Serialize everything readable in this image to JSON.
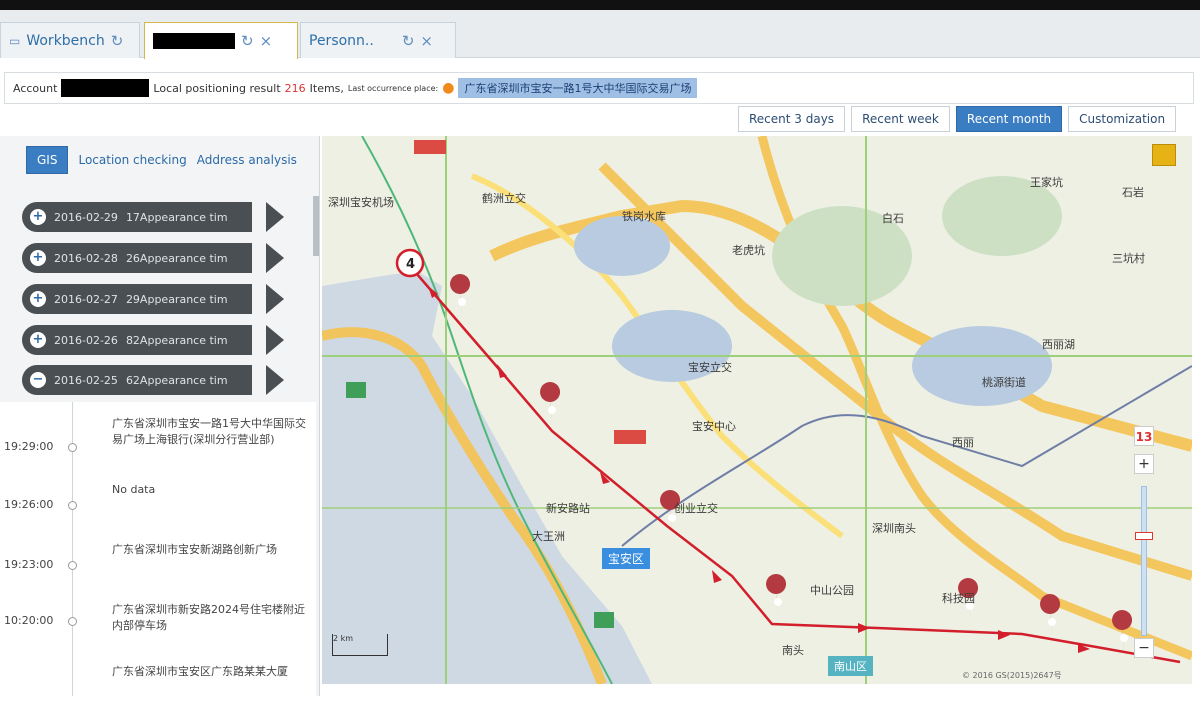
{
  "tabs": [
    {
      "label": "Workbench",
      "icon": "monitor-icon",
      "refresh_icon": "↻"
    },
    {
      "label": "",
      "refresh_icon": "↻",
      "close_icon": "×"
    },
    {
      "label": "Personn..",
      "refresh_icon": "↻",
      "close_icon": "×"
    }
  ],
  "infobar": {
    "account_label": "Account",
    "result_label": "Local positioning result",
    "count": "216",
    "items_label": "Items,",
    "last_place_label": "Last occurrence place:",
    "place_value": "广东省深圳市宝安一路1号大中华国际交易广场"
  },
  "ranges": [
    "Recent 3 days",
    "Recent week",
    "Recent month",
    "Customization"
  ],
  "left_tabs": [
    "GIS",
    "Location checking",
    "Address analysis"
  ],
  "days": [
    {
      "date": "2016-02-29",
      "count": "17Appearance tim",
      "sign": "+"
    },
    {
      "date": "2016-02-28",
      "count": "26Appearance tim",
      "sign": "+"
    },
    {
      "date": "2016-02-27",
      "count": "29Appearance tim",
      "sign": "+"
    },
    {
      "date": "2016-02-26",
      "count": "82Appearance tim",
      "sign": "+"
    },
    {
      "date": "2016-02-25",
      "count": "62Appearance tim",
      "sign": "−"
    }
  ],
  "timeline": [
    {
      "time": "19:29:00",
      "text": "广东省深圳市宝安一路1号大中华国际交易广场上海银行(深圳分行营业部)"
    },
    {
      "time": "19:26:00",
      "text": "No data"
    },
    {
      "time": "19:23:00",
      "text": "广东省深圳市宝安新湖路创新广场"
    },
    {
      "time": "10:20:00",
      "text": "广东省深圳市新安路2024号住宅楼附近内部停车场"
    },
    {
      "time": "",
      "text": "广东省深圳市宝安区广东路某某大厦"
    }
  ],
  "map": {
    "zoom_level": "13",
    "zoom_in": "+",
    "zoom_out": "−",
    "route_start_label": "4",
    "district_badge": "宝安区",
    "district_badge2": "南山区",
    "scale_label": "2 km",
    "copyright": "© 2016 GS(2015)2647号",
    "labels": {
      "airport": "深圳宝安机场",
      "hexi": "鹤洲立交",
      "tianhu": "铁岗水库",
      "laohukeng": "老虎坑",
      "baoan_lijiao": "宝安立交",
      "taoyuan": "桃源街道",
      "xili": "西丽",
      "baoan_center": "宝安中心",
      "xinghe": "新安路站",
      "xingye": "创业立交",
      "dawangzhou": "大王洲",
      "shenzhen_nanshan": "深圳南头",
      "zhongshan": "中山公园",
      "kejiyuan": "科技园",
      "nantou": "南头",
      "shiyan": "石岩",
      "wangjia": "王家坑",
      "xilihu": "西丽湖",
      "baishi": "白石",
      "sanqi": "三坑村"
    }
  }
}
